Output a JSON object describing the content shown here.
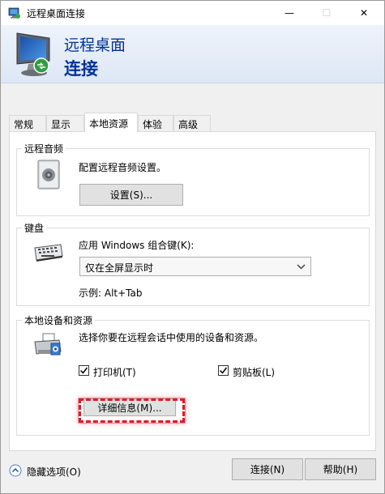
{
  "window": {
    "title": "远程桌面连接",
    "minimize_glyph": "—",
    "maximize_glyph": "☐",
    "close_glyph": "✕"
  },
  "banner": {
    "line1": "远程桌面",
    "line2": "连接"
  },
  "tabs": [
    {
      "label": "常规",
      "active": false
    },
    {
      "label": "显示",
      "active": false
    },
    {
      "label": "本地资源",
      "active": true
    },
    {
      "label": "体验",
      "active": false
    },
    {
      "label": "高级",
      "active": false
    }
  ],
  "audio": {
    "legend": "远程音频",
    "description": "配置远程音频设置。",
    "settings_button": "设置(S)..."
  },
  "keyboard": {
    "legend": "键盘",
    "apply_label": "应用 Windows 组合键(K):",
    "selected_option": "仅在全屏显示时",
    "example": "示例: Alt+Tab"
  },
  "devices": {
    "legend": "本地设备和资源",
    "description": "选择你要在远程会话中使用的设备和资源。",
    "printer_label": "打印机(T)",
    "printer_checked": true,
    "clipboard_label": "剪贴板(L)",
    "clipboard_checked": true,
    "more_button": "详细信息(M)..."
  },
  "footer": {
    "hide_options": "隐藏选项(O)",
    "connect_button": "连接(N)",
    "help_button": "帮助(H)"
  },
  "colors": {
    "banner_text": "#003399",
    "highlight": "#d9202a"
  }
}
